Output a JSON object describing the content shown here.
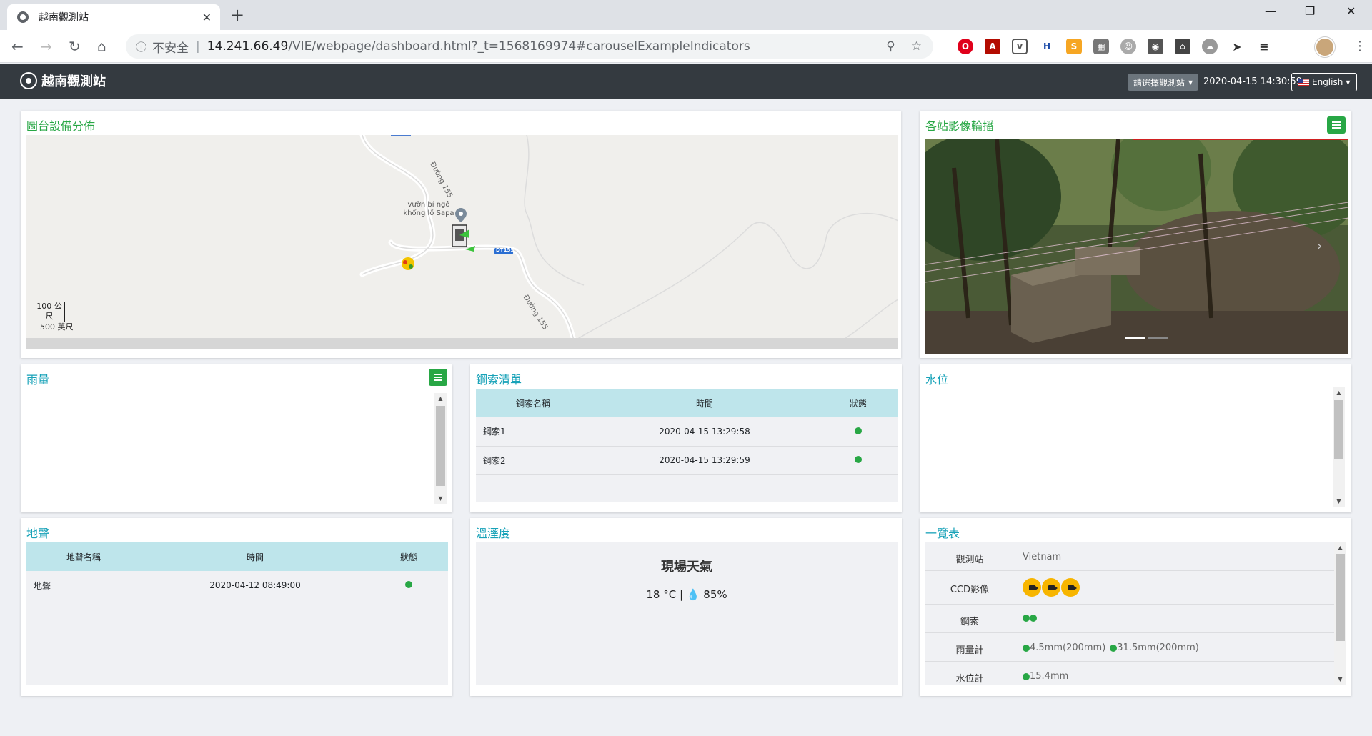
{
  "browser": {
    "tab_title": "越南觀測站",
    "tab_close": "✕",
    "new_tab": "+",
    "insecure_label": "不安全",
    "separator": "|",
    "url_host": "14.241.66.49",
    "url_rest": "/VIE/webpage/dashboard.html?_t=1568169974#carouselExampleIndicators",
    "extensions": [
      "opera-icon",
      "pdf-icon",
      "pocket-icon",
      "h-icon",
      "smartpdf-icon",
      "sheet-icon",
      "face-icon",
      "clip-icon",
      "home-icon",
      "cloud-icon",
      "send-icon",
      "playlist-icon"
    ]
  },
  "app": {
    "brand": "越南觀測站",
    "station_select": "請選擇觀測站",
    "datetime": "2020-04-15 14:30:59",
    "language": "English"
  },
  "map_card": {
    "title": "圖台設備分佈",
    "labels": {
      "road1": "Đường 155",
      "poi": "vườn bí ngô khổng lồ Sapa",
      "road2": "Đường 155",
      "road_badge": "DT155"
    },
    "scale": {
      "top": "100 公尺",
      "bottom": "500 英尺"
    }
  },
  "camera_card": {
    "title": "各站影像輪播"
  },
  "rain_card": {
    "title": "雨量"
  },
  "cable_card": {
    "title": "鋼索清單",
    "headers": [
      "鋼索名稱",
      "時間",
      "狀態"
    ],
    "rows": [
      {
        "name": "鋼索1",
        "time": "2020-04-15 13:29:58"
      },
      {
        "name": "鋼索2",
        "time": "2020-04-15 13:29:59"
      }
    ]
  },
  "water_card": {
    "title": "水位"
  },
  "quake_card": {
    "title": "地聲",
    "headers": [
      "地聲名稱",
      "時間",
      "狀態"
    ],
    "rows": [
      {
        "name": "地聲",
        "time": "2020-04-12 08:49:00"
      }
    ]
  },
  "weather_card": {
    "title": "溫溼度",
    "heading": "現場天氣",
    "temperature": "18 °C",
    "humidity": "85%"
  },
  "overview_card": {
    "title": "一覽表",
    "rows": {
      "station": {
        "label": "觀測站",
        "value": "Vietnam"
      },
      "ccd": {
        "label": "CCD影像"
      },
      "cable": {
        "label": "鋼索"
      },
      "rain": {
        "label": "雨量計",
        "v1": "4.5mm(200mm)",
        "v2": "31.5mm(200mm)"
      },
      "water": {
        "label": "水位計",
        "v1": "15.4mm"
      }
    }
  },
  "colors": {
    "accent": "#17a2b8",
    "ok": "#28a745",
    "navbar": "#343a40",
    "camera_badge": "#f7b500"
  }
}
